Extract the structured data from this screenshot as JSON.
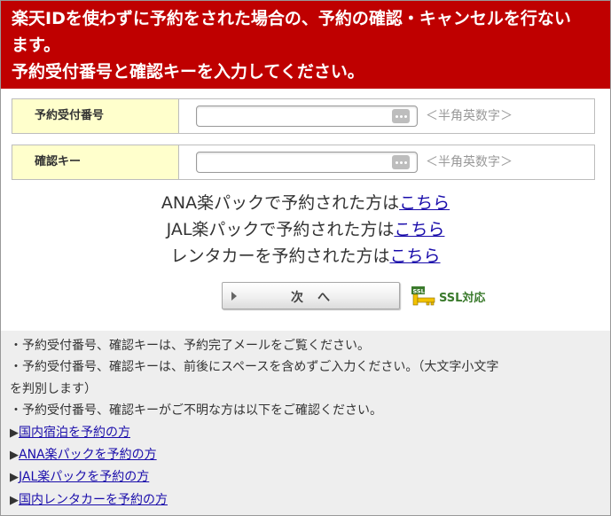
{
  "header": {
    "line1": "楽天IDを使わずに予約をされた場合の、予約の確認・キャンセルを行ない",
    "line2": "ます。",
    "line3": "予約受付番号と確認キーを入力してください。"
  },
  "form": {
    "reservation_number": {
      "label": "予約受付番号",
      "value": "",
      "placeholder": "",
      "hint": "＜半角英数字＞"
    },
    "confirmation_key": {
      "label": "確認キー",
      "value": "",
      "placeholder": "",
      "hint": "＜半角英数字＞"
    }
  },
  "links": [
    {
      "text": "ANA楽パックで予約された方は",
      "link": "こちら"
    },
    {
      "text": "JAL楽パックで予約された方は",
      "link": "こちら"
    },
    {
      "text": "レンタカーを予約された方は",
      "link": "こちら"
    }
  ],
  "next_button": {
    "label": "次　へ"
  },
  "ssl": {
    "icon": "ssl-key-icon",
    "label": "SSL対応",
    "icon_text": "SSL"
  },
  "notes": {
    "items": [
      "・予約受付番号、確認キーは、予約完了メールをご覧ください。",
      "・予約受付番号、確認キーは、前後にスペースを含めずご入力ください。（大文字小文字",
      "を判別します）",
      "・予約受付番号、確認キーがご不明な方は以下をご確認ください。"
    ],
    "arrow": "▶",
    "nav_links": [
      "国内宿泊を予約の方",
      "ANA楽パックを予約の方",
      "JAL楽パックを予約の方",
      "国内レンタカーを予約の方"
    ]
  },
  "colors": {
    "header_bg": "#bf0000",
    "label_bg": "#ffffcc",
    "link": "#1a0dab",
    "notes_bg": "#eeeeee",
    "ssl_green": "#3a7a2c"
  }
}
